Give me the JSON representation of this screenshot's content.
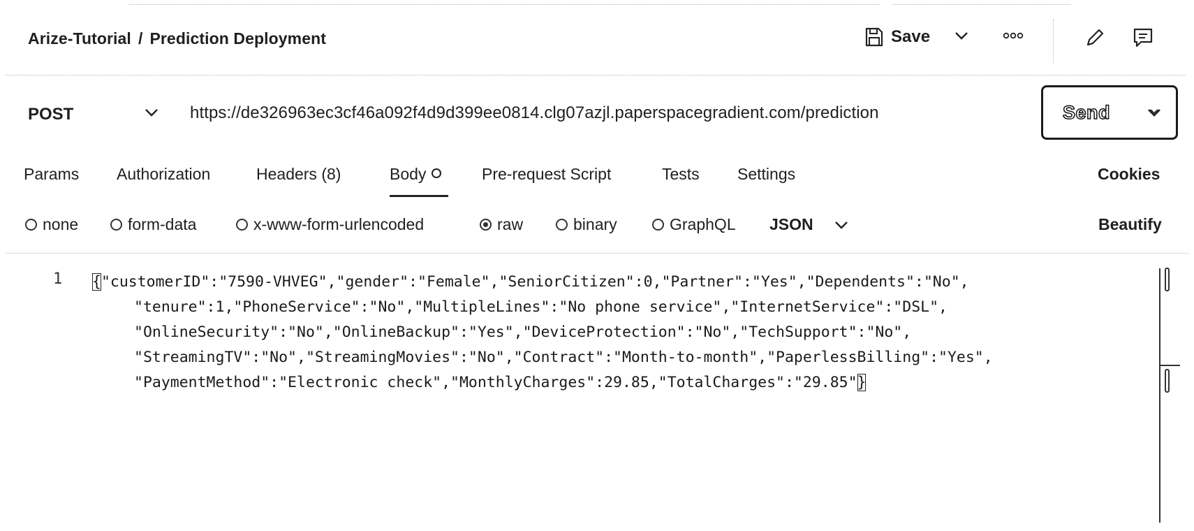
{
  "header": {
    "collection": "Arize-Tutorial",
    "separator": "/",
    "request_name": "Prediction Deployment",
    "save_label": "Save"
  },
  "request": {
    "method": "POST",
    "url": "https://de326963ec3cf46a092f4d9d399ee0814.clg07azjl.paperspacegradient.com/prediction",
    "send_label": "Send"
  },
  "tabs": [
    {
      "label": "Params"
    },
    {
      "label": "Authorization"
    },
    {
      "label": "Headers (8)"
    },
    {
      "label": "Body",
      "active": true
    },
    {
      "label": "Pre-request Script"
    },
    {
      "label": "Tests"
    },
    {
      "label": "Settings"
    }
  ],
  "cookies_label": "Cookies",
  "body_types": [
    {
      "label": "none",
      "checked": false
    },
    {
      "label": "form-data",
      "checked": false
    },
    {
      "label": "x-www-form-urlencoded",
      "checked": false
    },
    {
      "label": "raw",
      "checked": true
    },
    {
      "label": "binary",
      "checked": false
    },
    {
      "label": "GraphQL",
      "checked": false
    }
  ],
  "raw_format": "JSON",
  "beautify_label": "Beautify",
  "editor": {
    "line_number": "1",
    "open_brace": "{",
    "close_brace": "}",
    "lines": [
      "\"customerID\":\"7590-VHVEG\",\"gender\":\"Female\",\"SeniorCitizen\":0,\"Partner\":\"Yes\",\"Dependents\":\"No\",",
      "\"tenure\":1,\"PhoneService\":\"No\",\"MultipleLines\":\"No phone service\",\"InternetService\":\"DSL\",",
      "\"OnlineSecurity\":\"No\",\"OnlineBackup\":\"Yes\",\"DeviceProtection\":\"No\",\"TechSupport\":\"No\",",
      "\"StreamingTV\":\"No\",\"StreamingMovies\":\"No\",\"Contract\":\"Month-to-month\",\"PaperlessBilling\":\"Yes\",",
      "\"PaymentMethod\":\"Electronic check\",\"MonthlyCharges\":29.85,\"TotalCharges\":\"29.85\""
    ]
  }
}
